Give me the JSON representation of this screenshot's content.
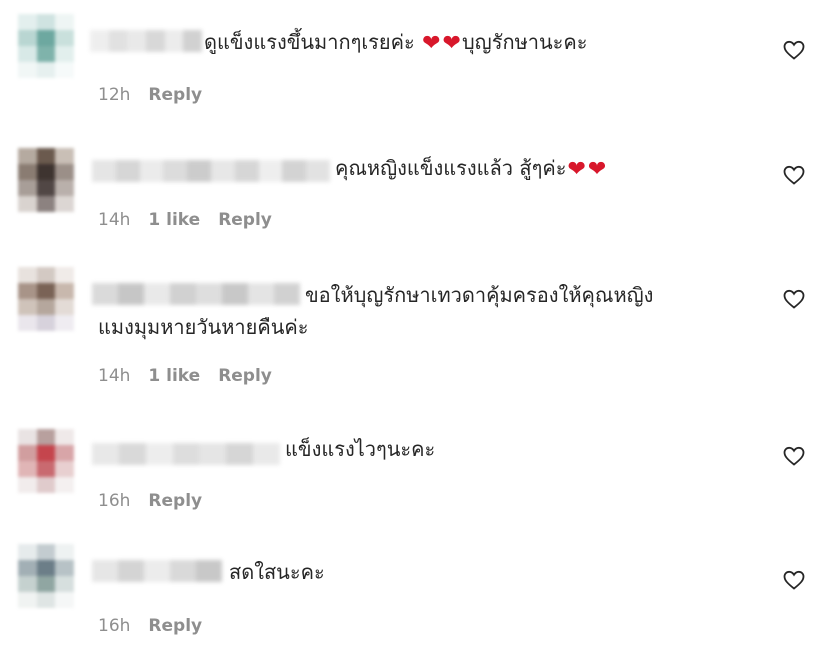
{
  "comments": [
    {
      "text": "ดูแข็งแรงขึ้นมากๆเรยค่ะ ",
      "text_after": "บุญรักษานะคะ",
      "hearts": 2,
      "time": "12h",
      "likes": "",
      "reply": "Reply",
      "like_icon": "heart-outline-icon"
    },
    {
      "text": "คุณหญิงแข็งแรงแล้ว สู้ๆค่ะ",
      "text_after": "",
      "hearts": 2,
      "time": "14h",
      "likes": "1 like",
      "reply": "Reply",
      "like_icon": "heart-outline-icon"
    },
    {
      "text": "ขอให้บุญรักษาเทวดาคุ้มครองให้คุณหญิง",
      "text_line2": "แมงมุมหายวันหายคืนค่ะ",
      "hearts": 0,
      "time": "14h",
      "likes": "1 like",
      "reply": "Reply",
      "like_icon": "heart-outline-icon"
    },
    {
      "text": "แข็งแรงไวๆนะคะ",
      "hearts": 0,
      "time": "16h",
      "likes": "",
      "reply": "Reply",
      "like_icon": "heart-outline-icon"
    },
    {
      "text": "สดใสนะคะ",
      "hearts": 0,
      "time": "16h",
      "likes": "",
      "reply": "Reply",
      "like_icon": "heart-outline-icon"
    }
  ],
  "colors": {
    "text": "#262626",
    "meta": "#8e8e8e",
    "emoji_heart": "#d8172b"
  }
}
